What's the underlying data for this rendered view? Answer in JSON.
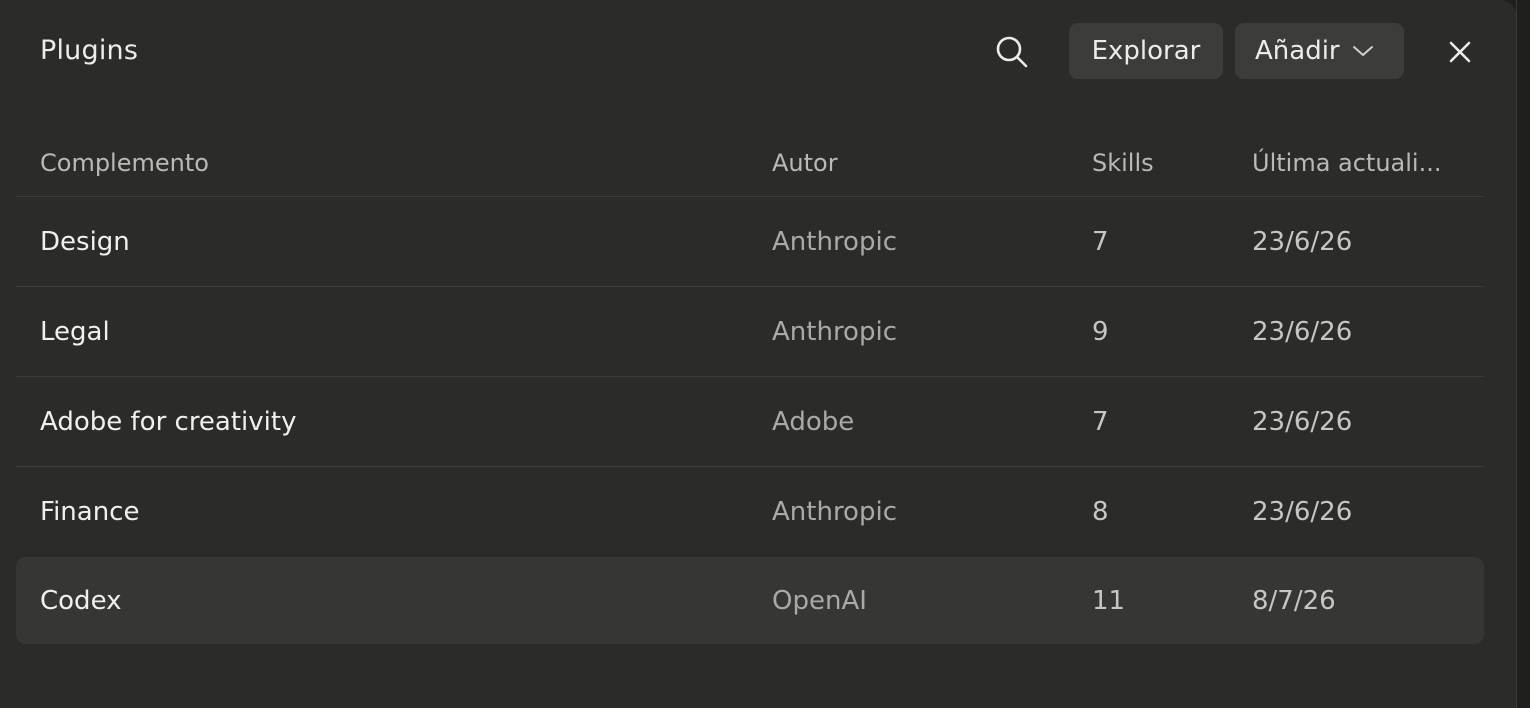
{
  "header": {
    "title": "Plugins",
    "explore_label": "Explorar",
    "add_label": "Añadir"
  },
  "table": {
    "columns": [
      "Complemento",
      "Autor",
      "Skills",
      "Última actuali..."
    ],
    "rows": [
      {
        "name": "Design",
        "author": "Anthropic",
        "skills": "7",
        "updated": "23/6/26"
      },
      {
        "name": "Legal",
        "author": "Anthropic",
        "skills": "9",
        "updated": "23/6/26"
      },
      {
        "name": "Adobe for creativity",
        "author": "Adobe",
        "skills": "7",
        "updated": "23/6/26"
      },
      {
        "name": "Finance",
        "author": "Anthropic",
        "skills": "8",
        "updated": "23/6/26"
      },
      {
        "name": "Codex",
        "author": "OpenAI",
        "skills": "11",
        "updated": "8/7/26"
      }
    ]
  },
  "icons": {
    "search": "search-icon",
    "chevron": "chevron-down-icon",
    "close": "close-icon"
  },
  "colors": {
    "panel_bg": "#2b2b2a",
    "button_bg": "#3c3c3a",
    "highlight_row_bg": "#363634"
  }
}
